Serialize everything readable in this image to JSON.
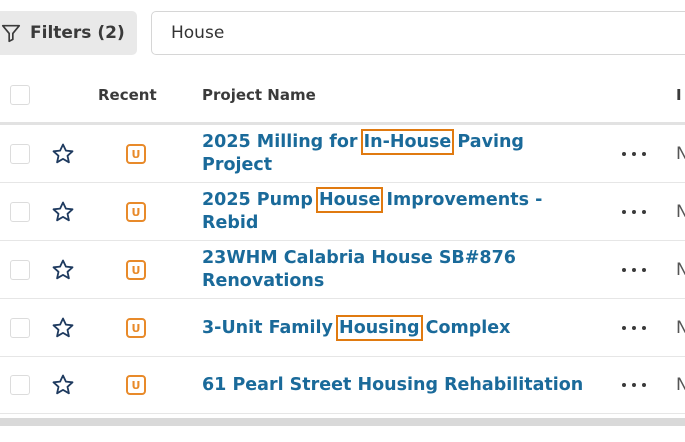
{
  "toolbar": {
    "filters_label": "Filters (2)",
    "search_value": "House"
  },
  "table": {
    "headers": {
      "recent": "Recent",
      "project_name": "Project Name",
      "next_col_truncated": "I"
    },
    "badge_letter": "U",
    "rows": [
      {
        "name_parts": [
          "2025 Milling for ",
          "In-House",
          " Paving Project"
        ],
        "truncated": "N"
      },
      {
        "name_parts": [
          "2025 Pump ",
          "House",
          " Improvements - Rebid"
        ],
        "truncated": "N"
      },
      {
        "name_parts": [
          "23WHM Calabria House SB#876 Renovations"
        ],
        "truncated": "N"
      },
      {
        "name_parts": [
          "3-Unit Family ",
          "Housing",
          " Complex"
        ],
        "truncated": "N"
      },
      {
        "name_parts": [
          "61 Pearl Street Housing Rehabilitation"
        ],
        "truncated": "N"
      }
    ]
  },
  "colors": {
    "link": "#1a6a9a",
    "highlight_outline": "#e07a10",
    "badge": "#e88a2a"
  }
}
